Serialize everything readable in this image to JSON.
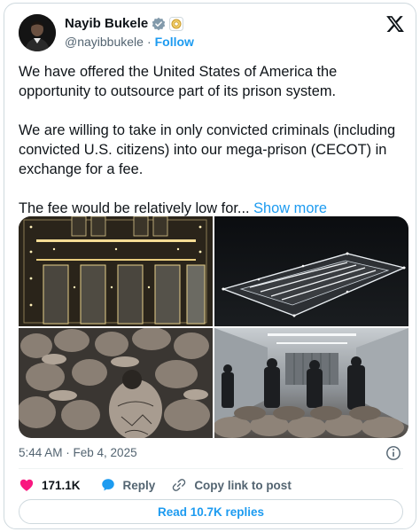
{
  "author": {
    "name": "Nayib Bukele",
    "handle": "@nayibbukele",
    "separator": "·",
    "follow_label": "Follow"
  },
  "tweet": {
    "paragraphs": [
      "We have offered the United States of America the opportunity to outsource part of its prison system.",
      "We are willing to take in only convicted criminals (including convicted U.S. citizens) into our mega-prison (CECOT) in exchange for a fee.",
      "The fee would be relatively low for..."
    ],
    "show_more_label": "Show more"
  },
  "media": {
    "photos": [
      {
        "name": "prison-aerial-night-photo"
      },
      {
        "name": "prison-complex-lights-photo"
      },
      {
        "name": "inmates-seated-photo"
      },
      {
        "name": "guards-inmates-hall-photo"
      }
    ]
  },
  "meta": {
    "timestamp": "5:44 AM · Feb 4, 2025"
  },
  "actions": {
    "likes_count": "171.1K",
    "reply_label": "Reply",
    "copy_link_label": "Copy link to post",
    "read_replies_label": "Read 10.7K replies"
  },
  "colors": {
    "accent": "#1d9bf0",
    "like": "#f91880",
    "text": "#0f1419",
    "muted": "#536471",
    "border": "#cfd9de",
    "verified_badge": "#829aab",
    "affiliate_badge": "#e8b54a"
  }
}
